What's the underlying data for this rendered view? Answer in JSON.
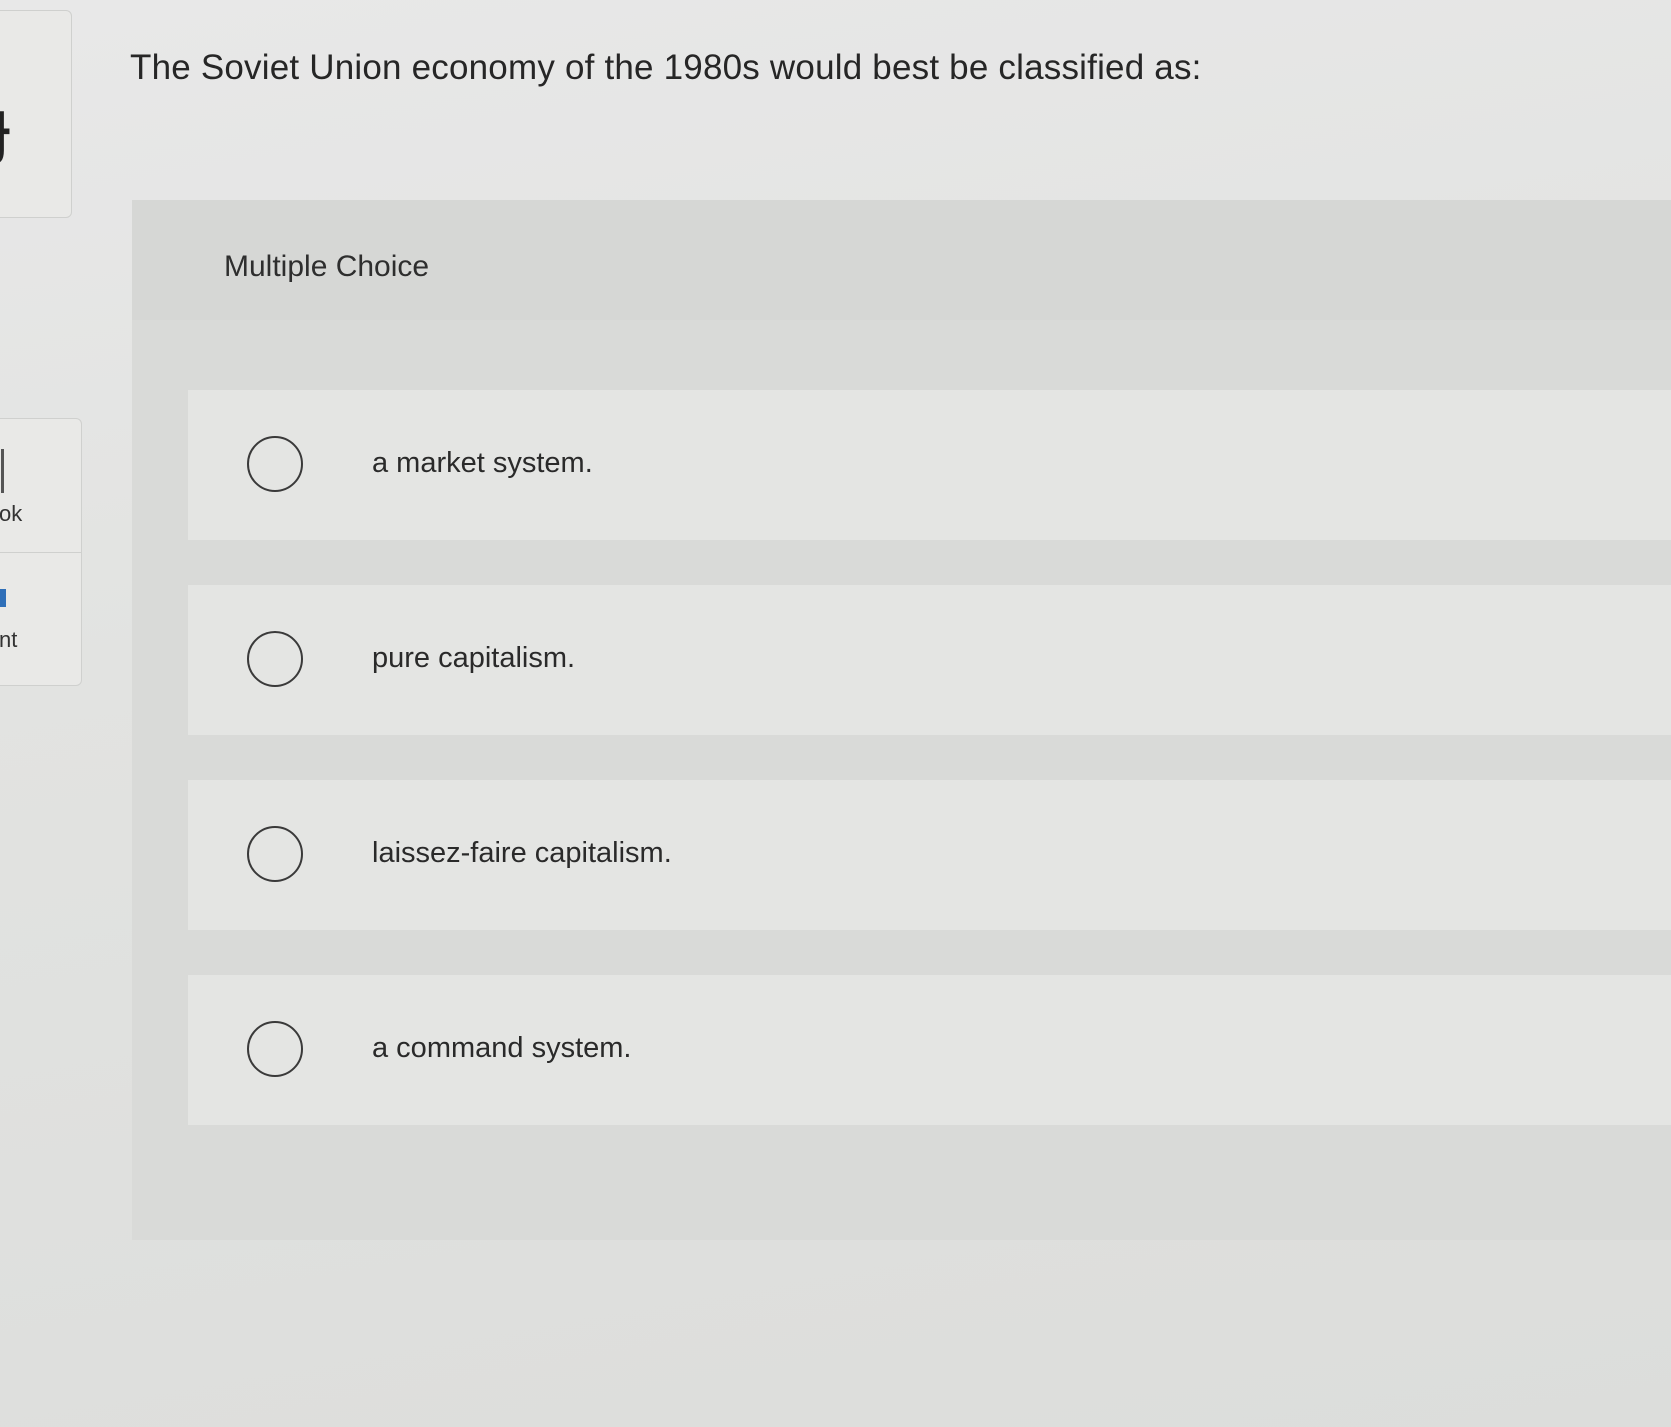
{
  "sidebar": {
    "items": [
      {
        "label": "ok"
      },
      {
        "label": "nt"
      }
    ]
  },
  "question": {
    "text": "The Soviet Union economy of the 1980s would best be classified as:"
  },
  "panel": {
    "title": "Multiple Choice"
  },
  "choices": [
    {
      "label": "a market system.",
      "selected": false
    },
    {
      "label": "pure capitalism.",
      "selected": false
    },
    {
      "label": "laissez-faire capitalism.",
      "selected": false
    },
    {
      "label": "a command system.",
      "selected": false
    }
  ],
  "colors": {
    "background": "#e2e3e1",
    "panel": "#d9dad8",
    "choice_row": "#e4e5e3",
    "accent_blue": "#2f6fb8"
  }
}
